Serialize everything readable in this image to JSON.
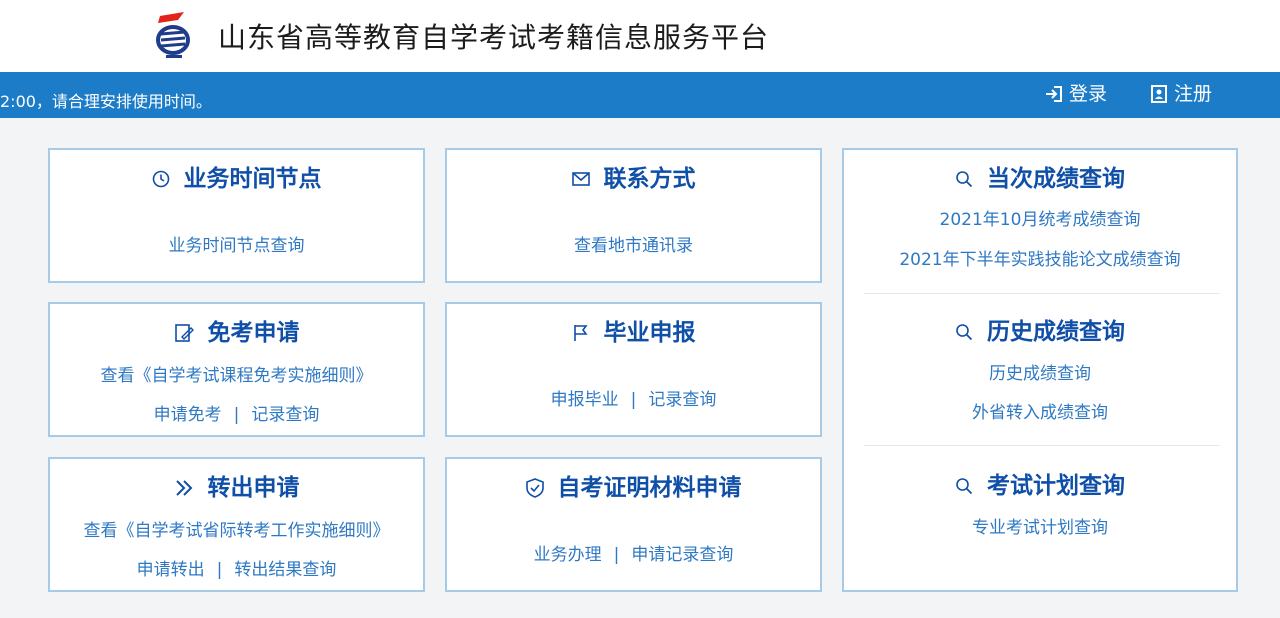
{
  "header": {
    "site_title": "山东省高等教育自学考试考籍信息服务平台"
  },
  "topbar": {
    "notice": "2:00，请合理安排使用时间。",
    "login_label": "登录",
    "register_label": "注册"
  },
  "cards": {
    "schedule": {
      "title": "业务时间节点",
      "link": "业务时间节点查询"
    },
    "contact": {
      "title": "联系方式",
      "link": "查看地市通讯录"
    },
    "exemption": {
      "title": "免考申请",
      "rule_link": "查看《自学考试课程免考实施细则》",
      "apply_link": "申请免考",
      "record_link": "记录查询"
    },
    "graduation": {
      "title": "毕业申报",
      "apply_link": "申报毕业",
      "record_link": "记录查询"
    },
    "transfer": {
      "title": "转出申请",
      "rule_link": "查看《自学考试省际转考工作实施细则》",
      "apply_link": "申请转出",
      "result_link": "转出结果查询"
    },
    "certificate": {
      "title": "自考证明材料申请",
      "handle_link": "业务办理",
      "record_link": "申请记录查询"
    }
  },
  "right_panel": {
    "current_scores": {
      "title": "当次成绩查询",
      "links": [
        "2021年10月统考成绩查询",
        "2021年下半年实践技能论文成绩查询"
      ]
    },
    "history_scores": {
      "title": "历史成绩查询",
      "links": [
        "历史成绩查询",
        "外省转入成绩查询"
      ]
    },
    "exam_plan": {
      "title": "考试计划查询",
      "links": [
        "专业考试计划查询"
      ]
    }
  },
  "colors": {
    "topbar": "#1c7cc7",
    "card_title": "#0f4fa8",
    "link": "#2f79c4",
    "card_border": "#a7cbe6"
  }
}
